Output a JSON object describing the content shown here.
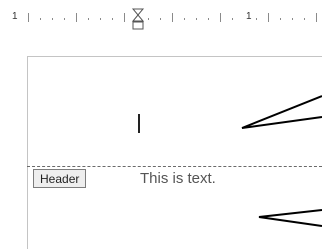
{
  "ruler": {
    "numbers": [
      "1",
      "1"
    ]
  },
  "editor": {
    "header_tag_label": "Header",
    "body_text": "This is text."
  },
  "icons": {
    "indent_marker": "hourglass-indent-marker-icon"
  },
  "colors": {
    "ruler_background": "#ffffff",
    "separator": "#6a6a6a",
    "header_tag_background": "#eeeeee",
    "text": "#555555"
  }
}
